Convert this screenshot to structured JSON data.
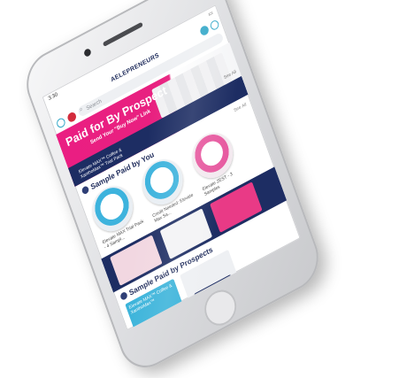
{
  "status": {
    "time": "3:30"
  },
  "brand": {
    "name": "AELEPRENEURS"
  },
  "search": {
    "placeholder": "Search"
  },
  "banner": {
    "title": "Paid for By Prospect",
    "subtitle": "Send Your \"Buy Now\" Link",
    "product": "Elevate MAX™ Coffee & XanthoMax™ Trial Pack",
    "see_all": "See All"
  },
  "section_you": {
    "title": "Sample Paid by You",
    "see_all": "See All",
    "cards": [
      {
        "caption": "Elevate MAX Trial Pack - 4 Sampl..."
      },
      {
        "caption": "Credit Needed: Elevate Max Sa..."
      },
      {
        "caption": "Elevate ZEST - 3 Samples"
      }
    ]
  },
  "section_prospects": {
    "title": "Sample Paid by Prospects",
    "tiles": [
      {
        "caption": "Elevate MAX™ Coffee & XanthoMax™"
      },
      {
        "caption": "",
        "button": "Request a Sample"
      }
    ]
  }
}
